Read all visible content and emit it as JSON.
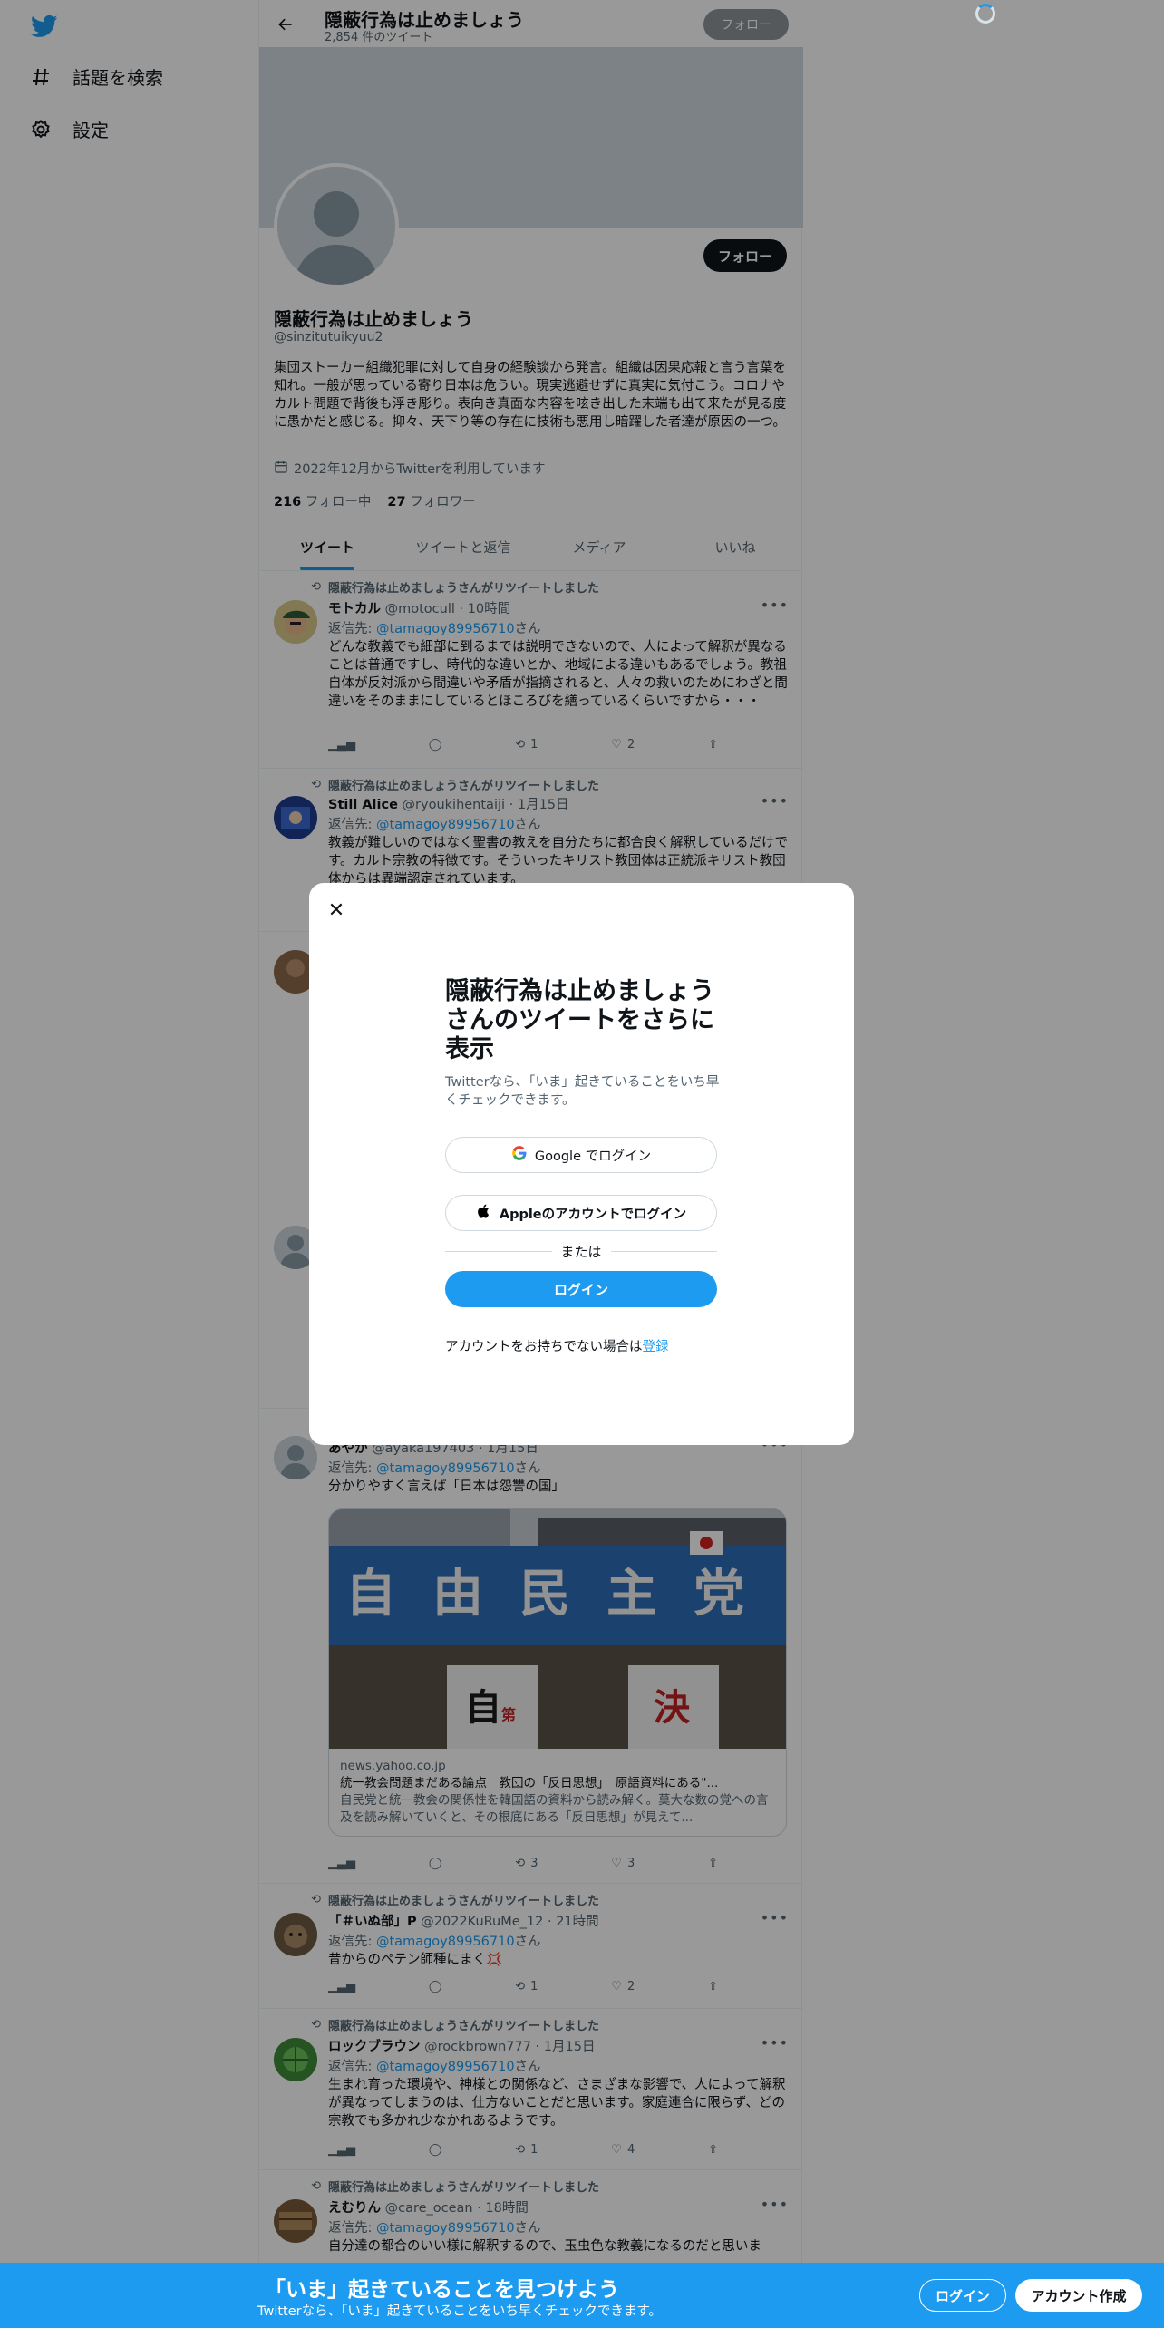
{
  "nav": {
    "explore_label": "話題を検索",
    "settings_label": "設定"
  },
  "topbar": {
    "title": "隠蔽行為は止めましょう",
    "tweet_count": "2,854 件のツイート",
    "follow_label": "フォロー"
  },
  "profile": {
    "follow_label": "フォロー",
    "name": "隠蔽行為は止めましょう",
    "handle": "@sinzitutuikyuu2",
    "bio": "集団ストーカー組織犯罪に対して自身の経験談から発言。組織は因果応報と言う言葉を知れ。一般が思っている寄り日本は危うい。現実逃避せずに真実に気付こう。コロナやカルト問題で背後も浮き彫り。表向き真面な内容を呟き出した末端も出て来たが見る度に愚かだと感じる。抑々、天下り等の存在に技術も悪用し暗躍した者達が原因の一つ。",
    "joined": "2022年12月からTwitterを利用しています",
    "following_count": "216",
    "following_label": "フォロー中",
    "followers_count": "27",
    "followers_label": "フォロワー"
  },
  "tabs": [
    {
      "label": "ツイート"
    },
    {
      "label": "ツイートと返信"
    },
    {
      "label": "メディア"
    },
    {
      "label": "いいね"
    }
  ],
  "tweets": [
    {
      "retweeted_by": "隠蔽行為は止めましょうさんがリツイートしました",
      "name": "モトカル",
      "handle_time": "@motocull · 10時間",
      "reply_prefix": "返信先: ",
      "reply_to": "@tamagoy89956710",
      "reply_suffix": "さん",
      "text": "どんな教義でも細部に到るまでは説明できないので、人によって解釈が異なることは普通ですし、時代的な違いとか、地域による違いもあるでしょう。教祖自体が反対派から間違いや矛盾が指摘されると、人々の救いのためにわざと間違いをそのままにしているとほころびを繕っているくらいですから・・・",
      "retweets": "1",
      "likes": "2"
    },
    {
      "retweeted_by": "隠蔽行為は止めましょうさんがリツイートしました",
      "name": "Still Alice",
      "handle_time": "@ryoukihentaiji · 1月15日",
      "reply_prefix": "返信先: ",
      "reply_to": "@tamagoy89956710",
      "reply_suffix": "さん",
      "text": "教義が難しいのではなく聖書の教えを自分たちに都合良く解釈しているだけです。カルト宗教の特徴です。そういったキリスト教団体は正統派キリスト教団体からは異端認定されています。"
    },
    {
      "name": "あやか",
      "handle_time": "@ayaka197403 · 1月15日",
      "reply_prefix": "返信先: ",
      "reply_to": "@tamagoy89956710",
      "reply_suffix": "さん",
      "text": "分かりやすく言えば「日本は怨讐の国」",
      "card_sign_chars": [
        "自",
        "由",
        "民",
        "主",
        "党"
      ],
      "card_lower_left": "自",
      "card_lower_left_small": "第",
      "card_lower_right": "決",
      "card_domain": "news.yahoo.co.jp",
      "card_title": "統一教会問題まだある論点　教団の「反日思想」　原語資料にある\"...",
      "card_desc": "自民党と統一教会の関係性を韓国語の資料から読み解く。莫大な数の覚への言及を読み解いていくと、その根底にある「反日思想」が見えて...",
      "retweets": "3",
      "likes": "3"
    },
    {
      "retweeted_by": "隠蔽行為は止めましょうさんがリツイートしました",
      "name": "「＃いぬ部」P",
      "handle_time": "@2022KuRuMe_12 · 21時間",
      "reply_prefix": "返信先: ",
      "reply_to": "@tamagoy89956710",
      "reply_suffix": "さん",
      "text": "昔からのペテン師種にまく💢",
      "retweets": "1",
      "likes": "2"
    },
    {
      "retweeted_by": "隠蔽行為は止めましょうさんがリツイートしました",
      "name": "ロックブラウン",
      "handle_time": "@rockbrown777 · 1月15日",
      "reply_prefix": "返信先: ",
      "reply_to": "@tamagoy89956710",
      "reply_suffix": "さん",
      "text": "生まれ育った環境や、神様との関係など、さまざまな影響で、人によって解釈が異なってしまうのは、仕方ないことだと思います。家庭連合に限らず、どの宗教でも多かれ少なかれあるようです。",
      "retweets": "1",
      "likes": "4"
    },
    {
      "retweeted_by": "隠蔽行為は止めましょうさんがリツイートしました",
      "name": "えむりん",
      "handle_time": "@care_ocean · 18時間",
      "reply_prefix": "返信先: ",
      "reply_to": "@tamagoy89956710",
      "reply_suffix": "さん",
      "text": "自分達の都合のいい様に解釈するので、玉虫色な教義になるのだと思いま"
    }
  ],
  "modal": {
    "title": "隠蔽行為は止めましょうさんのツイートをさらに表示",
    "subtitle": "Twitterなら、「いま」起きていることをいち早くチェックできます。",
    "google_label": "Google でログイン",
    "apple_label": "Appleのアカウントでログイン",
    "or_label": "または",
    "login_label": "ログイン",
    "signup_prefix": "アカウントをお持ちでない場合は",
    "signup_link": "登録"
  },
  "bottombar": {
    "title": "「いま」起きていることを見つけよう",
    "subtitle": "Twitterなら、「いま」起きていることをいち早くチェックできます。",
    "login_label": "ログイン",
    "signup_label": "アカウント作成"
  },
  "colors": {
    "accent": "#1d9bf0",
    "overlay": "rgba(0,0,0,0.4)",
    "text": "#0f1419",
    "muted": "#536471"
  }
}
